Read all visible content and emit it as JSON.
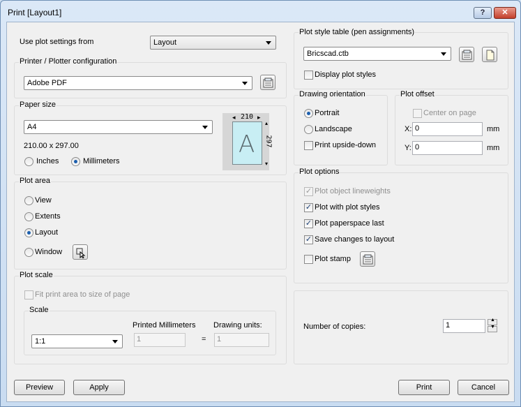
{
  "window": {
    "title": "Print [Layout1]",
    "help_label": "?",
    "close_label": "✕"
  },
  "plot_settings": {
    "label": "Use plot settings from",
    "value": "Layout"
  },
  "printer": {
    "group_title": "Printer / Plotter configuration",
    "value": "Adobe PDF"
  },
  "paper": {
    "group_title": "Paper size",
    "value": "A4",
    "dimensions": "210.00 x 297.00",
    "inches_label": "Inches",
    "mm_label": "Millimeters",
    "selected_unit": "Millimeters",
    "width_label": "210",
    "height_label": "297",
    "letter": "A"
  },
  "plot_area": {
    "group_title": "Plot area",
    "options": [
      "View",
      "Extents",
      "Layout",
      "Window"
    ],
    "selected": "Layout"
  },
  "plot_scale": {
    "group_title": "Plot scale",
    "fit_label": "Fit print area to size of page",
    "scale_group_title": "Scale",
    "scale_value": "1:1",
    "printed_mm_label": "Printed Millimeters",
    "drawing_units_label": "Drawing units:",
    "printed_mm_value": "1",
    "drawing_units_value": "1",
    "equals": "="
  },
  "plot_style": {
    "group_title": "Plot style table (pen assignments)",
    "value": "Bricscad.ctb",
    "display_label": "Display plot styles"
  },
  "orientation": {
    "group_title": "Drawing orientation",
    "portrait_label": "Portrait",
    "landscape_label": "Landscape",
    "upside_down_label": "Print upside-down",
    "selected": "Portrait"
  },
  "offset": {
    "group_title": "Plot offset",
    "center_label": "Center on page",
    "x_label": "X:",
    "x_value": "0",
    "y_label": "Y:",
    "y_value": "0",
    "unit": "mm"
  },
  "plot_options": {
    "group_title": "Plot options",
    "lineweights_label": "Plot object lineweights",
    "plot_styles_label": "Plot with plot styles",
    "paperspace_last_label": "Plot paperspace last",
    "save_changes_label": "Save changes to layout",
    "stamp_label": "Plot stamp"
  },
  "copies": {
    "label": "Number of copies:",
    "value": "1"
  },
  "buttons": {
    "preview": "Preview",
    "apply": "Apply",
    "print": "Print",
    "cancel": "Cancel"
  }
}
